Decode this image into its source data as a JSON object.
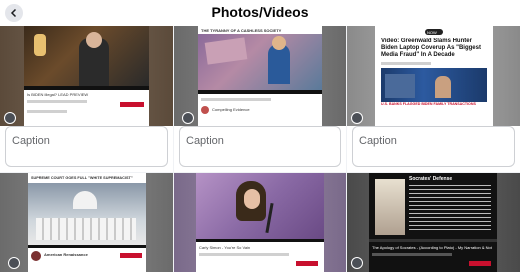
{
  "header": {
    "title": "Photos/Videos",
    "back_icon": "arrow-left-icon"
  },
  "captions": [
    "Caption",
    "Caption",
    "Caption"
  ],
  "thumbs": {
    "t1": {
      "meta": "Is BIDEN illegal? LEAD PREVIEW"
    },
    "t2": {
      "title": "THE TYRANNY OF A CASHLESS SOCIETY",
      "channel": "Compelling Evidence"
    },
    "t3": {
      "badge": "NOW",
      "headline": "Video: Greenwald Slams Hunter Biden Laptop Coverup As \"Biggest Media Fraud\" In A Decade",
      "lower_third": "U.S. BANKS FLAGGED BIDEN FAMILY TRANSACTIONS"
    },
    "t4": {
      "banner": "SUPREME COURT GOES FULL \"WHITE SUPREMACIST\"",
      "channel": "American Renaissance"
    },
    "t5": {
      "meta": "Carly Simon - You're So Vain"
    },
    "t6": {
      "title": "Socrates' Defense",
      "meta": "The Apology of Socrates - (According to Plato) - My Narration & Notes"
    }
  }
}
